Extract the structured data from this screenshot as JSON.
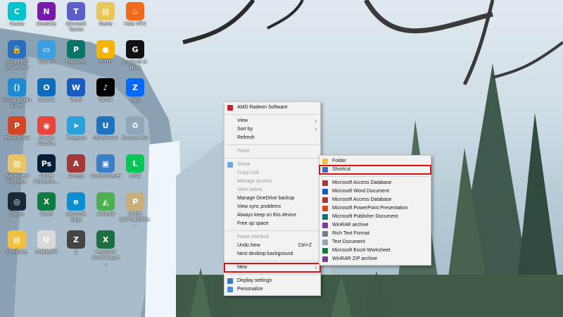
{
  "desktop": {
    "icons": [
      {
        "label": "Canva",
        "color": "#00c4cc",
        "glyph": "C"
      },
      {
        "label": "OneNote",
        "color": "#7719aa",
        "glyph": "N"
      },
      {
        "label": "Microsoft Teams",
        "color": "#5b5fc7",
        "glyph": "T"
      },
      {
        "label": "Game",
        "color": "#e8c75a",
        "glyph": "▤"
      },
      {
        "label": "Hola VPN",
        "color": "#f26b1d",
        "glyph": "♨"
      },
      {
        "label": "Smart PC Locker Pro",
        "color": "#2a6fbf",
        "glyph": "🔒"
      },
      {
        "label": "This PC",
        "color": "#3aa0e0",
        "glyph": "▭"
      },
      {
        "label": "Publisher",
        "color": "#077568",
        "glyph": "P"
      },
      {
        "label": "TOTP",
        "color": "#f4b400",
        "glyph": "●"
      },
      {
        "label": "Logitech G HUB",
        "color": "#111111",
        "glyph": "G"
      },
      {
        "label": "Visual Studio Code",
        "color": "#1f8ad2",
        "glyph": "⟨⟩"
      },
      {
        "label": "Outlook",
        "color": "#0f6cbd",
        "glyph": "O"
      },
      {
        "label": "Word",
        "color": "#185abd",
        "glyph": "W"
      },
      {
        "label": "TikTok",
        "color": "#000000",
        "glyph": "♪"
      },
      {
        "label": "Zalo",
        "color": "#0068ff",
        "glyph": "Z"
      },
      {
        "label": "PowerPoint",
        "color": "#d24726",
        "glyph": "P"
      },
      {
        "label": "Google Chrome",
        "color": "#e8453c",
        "glyph": "◉"
      },
      {
        "label": "Telegram",
        "color": "#2aa1da",
        "glyph": "➤"
      },
      {
        "label": "UltraViewer",
        "color": "#1e73be",
        "glyph": "U"
      },
      {
        "label": "Recycle Bin",
        "color": "#8fa7b8",
        "glyph": "♻"
      },
      {
        "label": "Bài Project Shortcut",
        "color": "#e9c46a",
        "glyph": "▤"
      },
      {
        "label": "Adobe Photosho...",
        "color": "#001e36",
        "glyph": "Ps"
      },
      {
        "label": "Access",
        "color": "#a4373a",
        "glyph": "A"
      },
      {
        "label": "Control Panel",
        "color": "#3b7fc4",
        "glyph": "▣"
      },
      {
        "label": "LINE",
        "color": "#06c755",
        "glyph": "L"
      },
      {
        "label": "Steam",
        "color": "#1b2838",
        "glyph": "◎"
      },
      {
        "label": "Excel",
        "color": "#107c41",
        "glyph": "X"
      },
      {
        "label": "Microsoft Edge",
        "color": "#0c8fd0",
        "glyph": "e"
      },
      {
        "label": "AirDroid",
        "color": "#4caf50",
        "glyph": "◭"
      },
      {
        "label": "PUBG BATTLEGRO...",
        "color": "#c8b07a",
        "glyph": "P"
      },
      {
        "label": "OneDrive",
        "color": "#f0c040",
        "glyph": "▤"
      },
      {
        "label": "UniKeyNT",
        "color": "#d9d9d9",
        "glyph": "U"
      },
      {
        "label": "Z",
        "color": "#444444",
        "glyph": "Z"
      },
      {
        "label": "KeyWord Excel Export ...",
        "color": "#1d6f42",
        "glyph": "X"
      }
    ]
  },
  "context_menu": {
    "items": [
      {
        "type": "item",
        "label": "AMD Radeon Software",
        "icon": "amd-icon",
        "color": "#d71f26"
      },
      {
        "type": "sep"
      },
      {
        "type": "item",
        "label": "View",
        "submenu": true
      },
      {
        "type": "item",
        "label": "Sort by",
        "submenu": true
      },
      {
        "type": "item",
        "label": "Refresh"
      },
      {
        "type": "sep"
      },
      {
        "type": "item",
        "label": "Paste",
        "disabled": true
      },
      {
        "type": "sep"
      },
      {
        "type": "item",
        "label": "Share",
        "disabled": true,
        "icon": "onedrive-icon",
        "color": "#6aa9e8"
      },
      {
        "type": "item",
        "label": "Copy Link",
        "disabled": true
      },
      {
        "type": "item",
        "label": "Manage access",
        "disabled": true
      },
      {
        "type": "item",
        "label": "View online",
        "disabled": true
      },
      {
        "type": "item",
        "label": "Manage OneDrive backup"
      },
      {
        "type": "item",
        "label": "View sync problems"
      },
      {
        "type": "item",
        "label": "Always keep on this device"
      },
      {
        "type": "item",
        "label": "Free up space"
      },
      {
        "type": "sep"
      },
      {
        "type": "item",
        "label": "Paste shortcut",
        "disabled": true
      },
      {
        "type": "item",
        "label": "Undo New",
        "shortcut": "Ctrl+Z"
      },
      {
        "type": "item",
        "label": "Next desktop background"
      },
      {
        "type": "sep"
      },
      {
        "type": "item",
        "label": "New",
        "submenu": true,
        "highlight": true
      },
      {
        "type": "sep"
      },
      {
        "type": "item",
        "label": "Display settings",
        "icon": "display-icon",
        "color": "#3b78c3"
      },
      {
        "type": "item",
        "label": "Personalize",
        "icon": "personalize-icon",
        "color": "#4a90d9"
      }
    ]
  },
  "new_submenu": {
    "items": [
      {
        "type": "item",
        "label": "Folder",
        "icon": "folder-icon",
        "color": "#f5c043"
      },
      {
        "type": "item",
        "label": "Shortcut",
        "icon": "shortcut-icon",
        "color": "#3d6fb6",
        "highlight": true
      },
      {
        "type": "sep"
      },
      {
        "type": "item",
        "label": "Microsoft Access Database",
        "icon": "access-icon",
        "color": "#a4373a"
      },
      {
        "type": "item",
        "label": "Microsoft Word Document",
        "icon": "word-icon",
        "color": "#185abd"
      },
      {
        "type": "item",
        "label": "Microsoft Access Database",
        "icon": "access-icon",
        "color": "#a4373a"
      },
      {
        "type": "item",
        "label": "Microsoft PowerPoint Presentation",
        "icon": "powerpoint-icon",
        "color": "#d24726"
      },
      {
        "type": "item",
        "label": "Microsoft Publisher Document",
        "icon": "publisher-icon",
        "color": "#077568"
      },
      {
        "type": "item",
        "label": "WinRAR archive",
        "icon": "winrar-icon",
        "color": "#7b3f99"
      },
      {
        "type": "item",
        "label": "Rich Text Format",
        "icon": "rtf-icon",
        "color": "#6f7d8c"
      },
      {
        "type": "item",
        "label": "Text Document",
        "icon": "text-icon",
        "color": "#9aa4ad"
      },
      {
        "type": "item",
        "label": "Microsoft Excel Worksheet",
        "icon": "excel-icon",
        "color": "#107c41"
      },
      {
        "type": "item",
        "label": "WinRAR ZIP archive",
        "icon": "winrar-zip-icon",
        "color": "#7b3f99"
      }
    ]
  },
  "colors": {
    "highlight_border": "#d11111",
    "menu_bg": "#f2f2f2"
  }
}
